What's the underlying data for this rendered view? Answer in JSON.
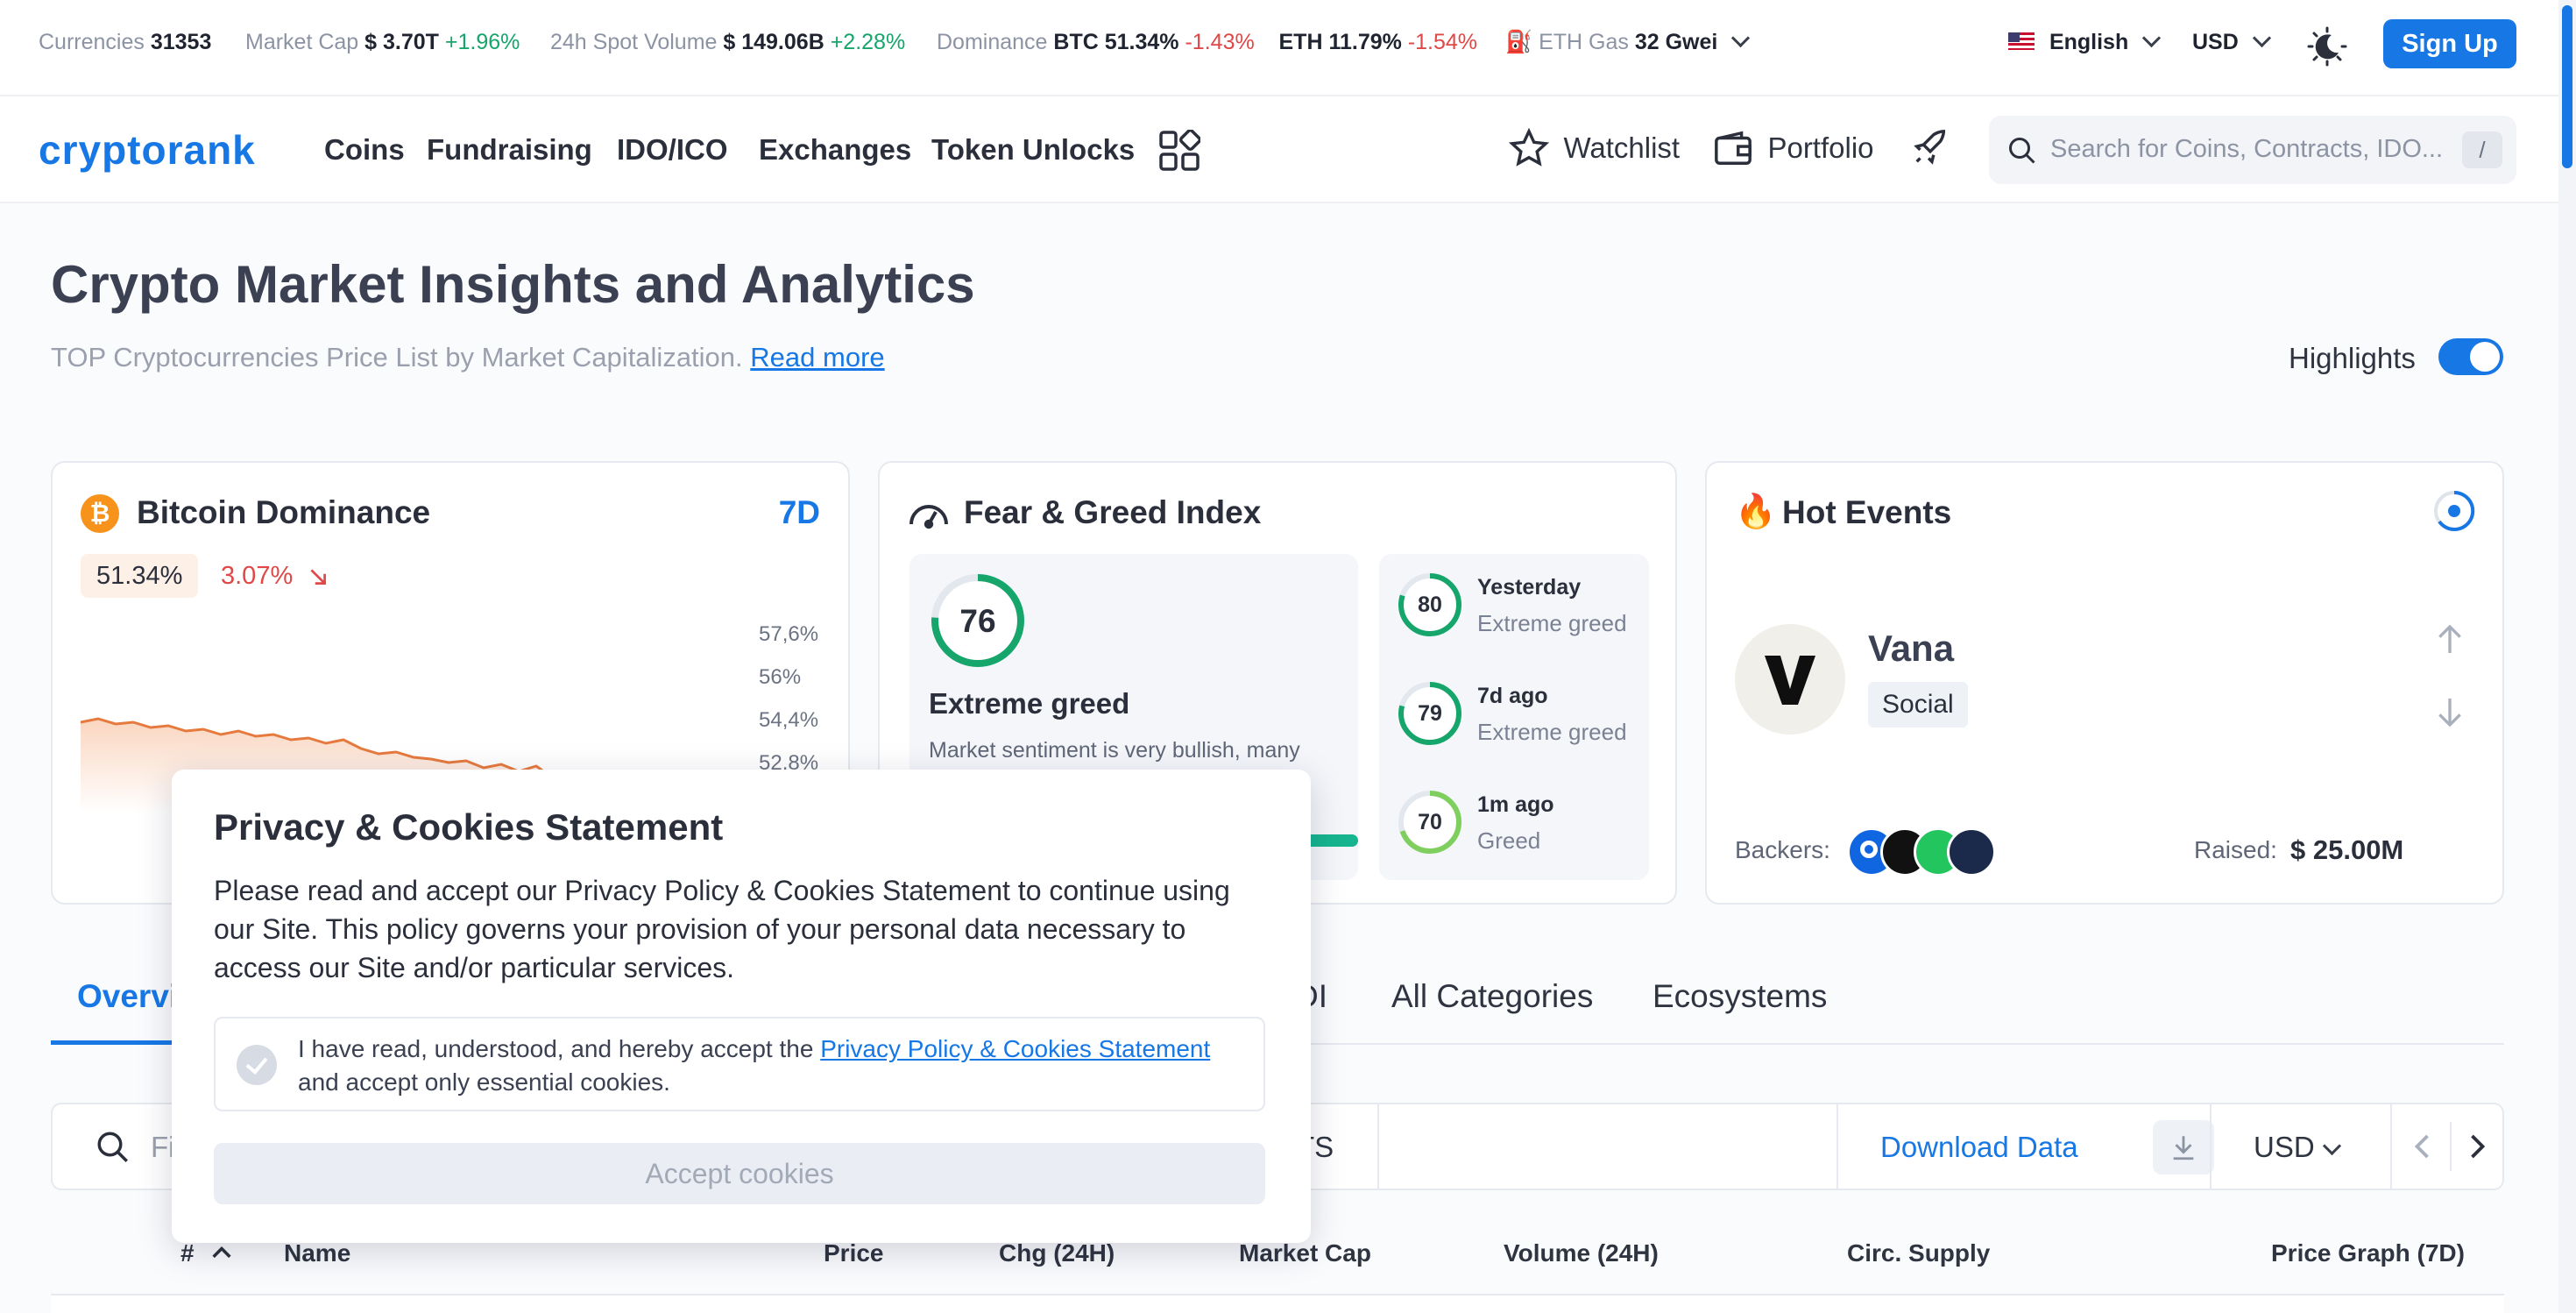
{
  "ticker": {
    "currencies_label": "Currencies",
    "currencies_value": "31353",
    "mcap_label": "Market Cap",
    "mcap_value": "$ 3.70T",
    "mcap_change": "+1.96%",
    "vol_label": "24h Spot Volume",
    "vol_value": "$ 149.06B",
    "vol_change": "+2.28%",
    "dom_label": "Dominance",
    "btc_label": "BTC 51.34%",
    "btc_change": "-1.43%",
    "eth_label": "ETH 11.79%",
    "eth_change": "-1.54%",
    "gas_label": "ETH Gas",
    "gas_value": "32 Gwei",
    "language": "English",
    "currency": "USD",
    "signup": "Sign Up"
  },
  "nav": {
    "logo": "cryptorank",
    "links": [
      "Coins",
      "Fundraising",
      "IDO/ICO",
      "Exchanges",
      "Token Unlocks"
    ],
    "watchlist": "Watchlist",
    "portfolio": "Portfolio",
    "search_placeholder": "Search for Coins, Contracts, IDO...",
    "search_key": "/"
  },
  "hero": {
    "title": "Crypto Market Insights and Analytics",
    "subtitle": "TOP Cryptocurrencies Price List by Market Capitalization.",
    "read_more": "Read more",
    "highlights": "Highlights"
  },
  "btc_card": {
    "title": "Bitcoin Dominance",
    "period": "7D",
    "value": "51.34%",
    "change": "3.07%",
    "ticks": [
      "57,6%",
      "56%",
      "54,4%",
      "52,8%"
    ]
  },
  "fg_card": {
    "title": "Fear & Greed Index",
    "current": "76",
    "current_label": "Extreme greed",
    "description": "Market sentiment is very bullish, many",
    "history": [
      {
        "value": "80",
        "when": "Yesterday",
        "label": "Extreme greed"
      },
      {
        "value": "79",
        "when": "7d ago",
        "label": "Extreme greed"
      },
      {
        "value": "70",
        "when": "1m ago",
        "label": "Greed"
      }
    ]
  },
  "hot_card": {
    "title": "Hot Events",
    "name": "Vana",
    "tag": "Social",
    "backers_label": "Backers:",
    "raised_label": "Raised:",
    "raised_value": "$ 25.00M"
  },
  "tabs": [
    "Overview",
    "DI",
    "All Categories",
    "Ecosystems"
  ],
  "filter": {
    "placeholder": "Fi",
    "partial": "TS",
    "download": "Download Data",
    "currency": "USD"
  },
  "table_headers": [
    "#",
    "Name",
    "Price",
    "Chg (24H)",
    "Market Cap",
    "Volume (24H)",
    "Circ. Supply",
    "Price Graph (7D)"
  ],
  "cookies": {
    "title": "Privacy & Cookies Statement",
    "body": "Please read and accept our Privacy Policy & Cookies Statement to continue using our Site. This policy governs your provision of your personal data necessary to access our Site and/or particular services.",
    "check_pre": "I have read, understood, and hereby accept the ",
    "check_link": "Privacy Policy & Cookies Statement",
    "check_post": " and accept only essential cookies.",
    "button": "Accept cookies"
  }
}
